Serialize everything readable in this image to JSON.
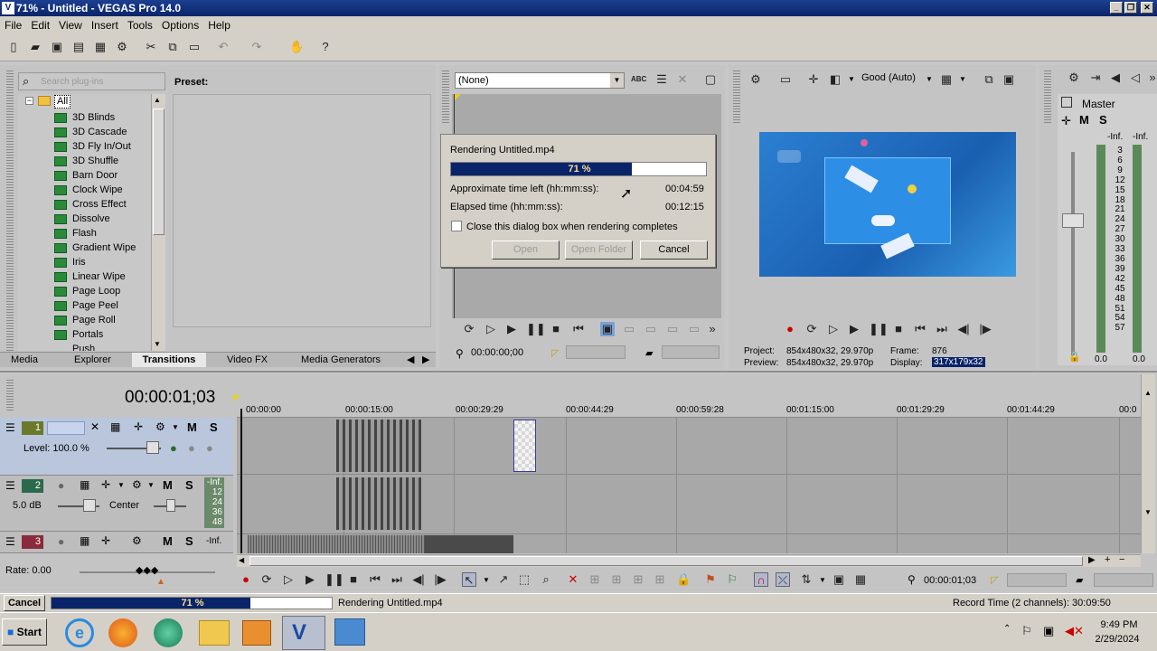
{
  "window": {
    "title": "71% - Untitled - VEGAS Pro 14.0"
  },
  "menu": [
    "File",
    "Edit",
    "View",
    "Insert",
    "Tools",
    "Options",
    "Help"
  ],
  "plugins": {
    "search_placeholder": "Search plug-ins",
    "root": "All",
    "items": [
      "3D Blinds",
      "3D Cascade",
      "3D Fly In/Out",
      "3D Shuffle",
      "Barn Door",
      "Clock Wipe",
      "Cross Effect",
      "Dissolve",
      "Flash",
      "Gradient Wipe",
      "Iris",
      "Linear Wipe",
      "Page Loop",
      "Page Peel",
      "Page Roll",
      "Portals",
      "Push"
    ],
    "preset_label": "Preset:"
  },
  "left_tabs": [
    "Media",
    "Explorer",
    "Transitions",
    "Video FX",
    "Media Generators"
  ],
  "trimmer": {
    "select_value": "(None)",
    "timecode": "00:00:00;00"
  },
  "render_dialog": {
    "title": "Rendering Untitled.mp4",
    "progress_text": "71 %",
    "progress": 0.71,
    "time_left_label": "Approximate time left (hh:mm:ss):",
    "time_left": "00:04:59",
    "elapsed_label": "Elapsed time (hh:mm:ss):",
    "elapsed": "00:12:15",
    "checkbox_label": "Close this dialog box when rendering completes",
    "open": "Open",
    "open_folder": "Open Folder",
    "cancel": "Cancel"
  },
  "preview": {
    "quality": "Good (Auto)",
    "project_label": "Project:",
    "project": "854x480x32, 29.970p",
    "preview_label": "Preview:",
    "preview": "854x480x32, 29.970p",
    "frame_label": "Frame:",
    "frame": "876",
    "display_label": "Display:",
    "display": "317x179x32"
  },
  "master": {
    "label": "Master",
    "inf_left": "-Inf.",
    "inf_right": "-Inf.",
    "scale": [
      "3",
      "6",
      "9",
      "12",
      "15",
      "18",
      "21",
      "24",
      "27",
      "30",
      "33",
      "36",
      "39",
      "42",
      "45",
      "48",
      "51",
      "54",
      "57"
    ],
    "bottom_left": "0.0",
    "bottom_right": "0.0"
  },
  "timeline": {
    "cursor_time": "00:00:01;03",
    "ruler": [
      "00:00:00",
      "00:00:15:00",
      "00:00:29:29",
      "00:00:44:29",
      "00:00:59:28",
      "00:01:15:00",
      "00:01:29:29",
      "00:01:44:29",
      "00:0"
    ],
    "track1": {
      "num": "1",
      "level": "Level: 100.0 %"
    },
    "track2": {
      "num": "2",
      "volume": "5.0 dB",
      "pan": "Center",
      "meter": [
        "-Inf.",
        "12",
        "24",
        "36",
        "48"
      ]
    },
    "track3": {
      "num": "3",
      "meter": "-Inf."
    },
    "rate": "Rate: 0.00",
    "transport_time": "00:00:01;03"
  },
  "statusbar": {
    "cancel": "Cancel",
    "progress_text": "71 %",
    "progress": 0.71,
    "message": "Rendering Untitled.mp4",
    "record_time": "Record Time (2 channels): 30:09:50"
  },
  "taskbar": {
    "start": "Start",
    "time": "9:49 PM",
    "date": "2/29/2024"
  }
}
